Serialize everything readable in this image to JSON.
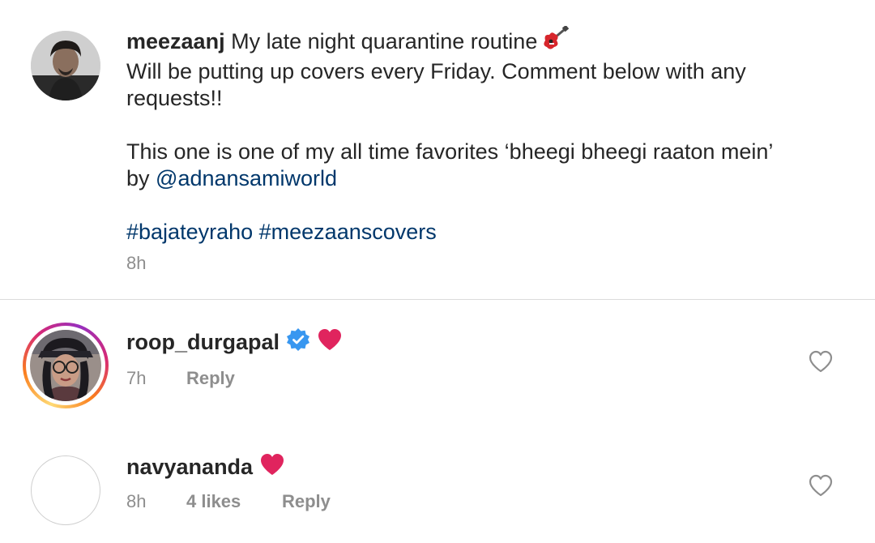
{
  "post": {
    "username": "meezaanj",
    "caption_lines": [
      "My late night quarantine routine",
      "Will be putting up covers every Friday. Comment below with any",
      "requests!!"
    ],
    "guitar_icon": "guitar-icon",
    "para2_line1": "This one is one of my all time favorites ‘bheegi bheegi raaton mein’",
    "para2_by": "by ",
    "mention": "@adnansamiworld",
    "hashtags": [
      "#bajateyraho",
      "#meezaanscovers"
    ],
    "time": "8h"
  },
  "comments": [
    {
      "username": "roop_durgapal",
      "verified": true,
      "text_emoji": "heart-icon",
      "time": "7h",
      "likes": "",
      "reply_label": "Reply",
      "has_story_ring": true
    },
    {
      "username": "navyananda",
      "verified": false,
      "text_emoji": "heart-icon",
      "time": "8h",
      "likes": "4 likes",
      "reply_label": "Reply",
      "has_story_ring": false
    }
  ],
  "colors": {
    "text": "#262626",
    "secondary": "#8e8e8e",
    "link": "#00376b",
    "verified": "#3897f0",
    "heart": "#e0245e",
    "divider": "#dbdbdb"
  }
}
